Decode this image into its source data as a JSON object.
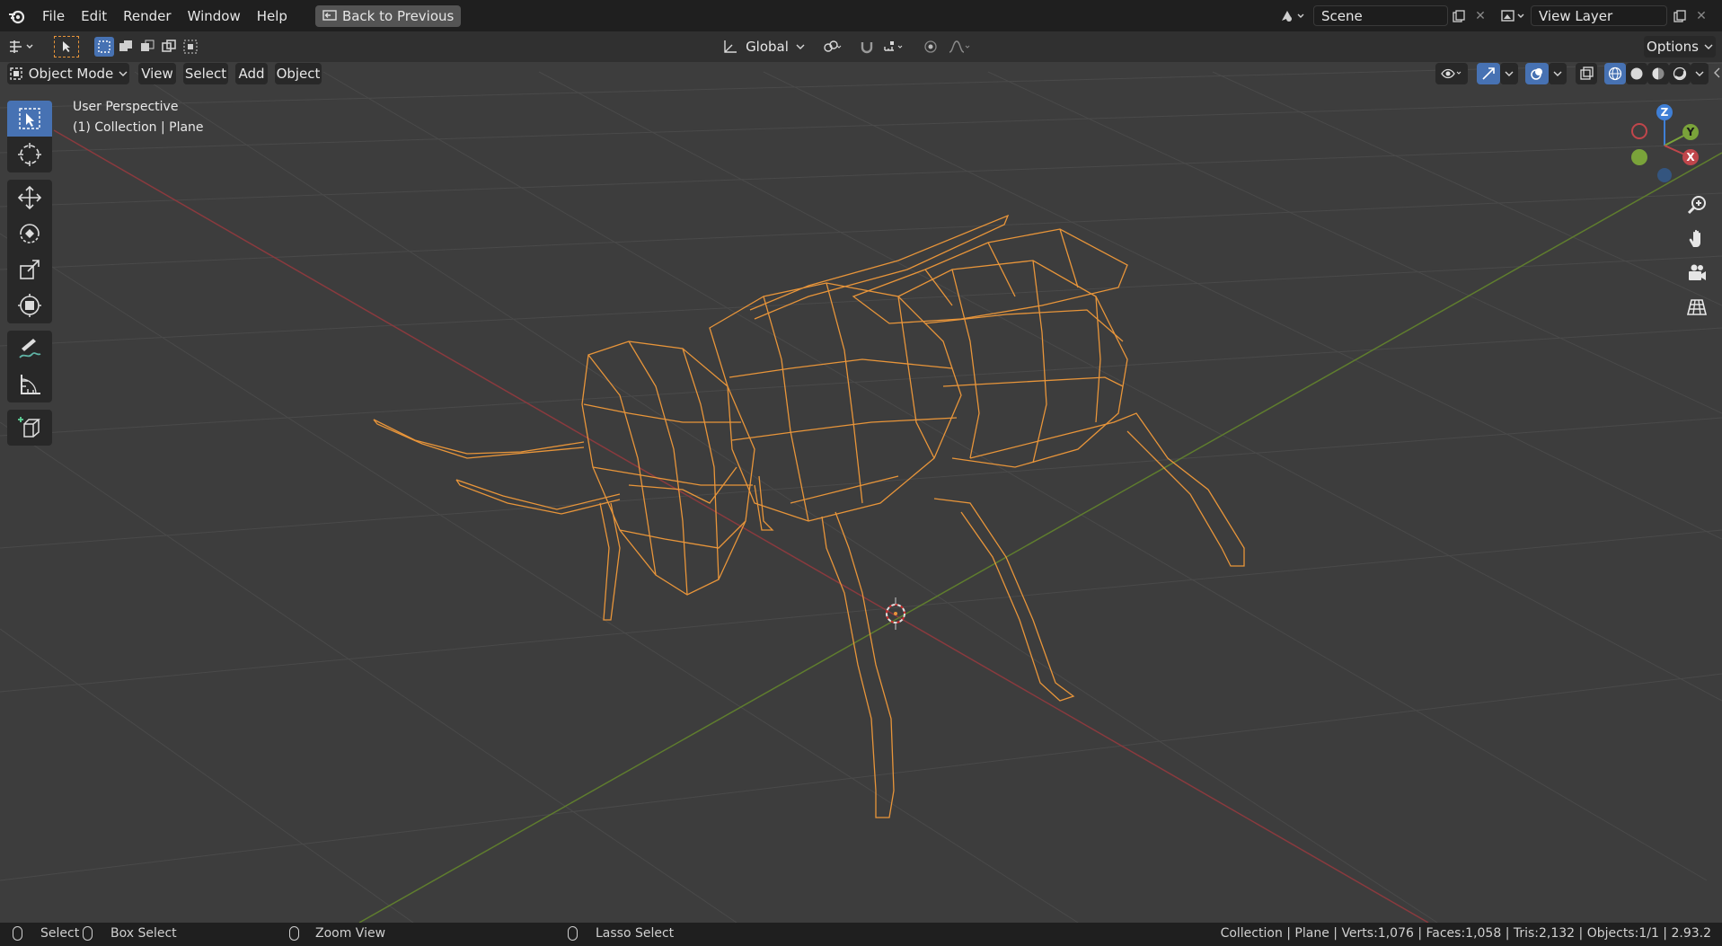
{
  "menu": {
    "items": [
      "File",
      "Edit",
      "Render",
      "Window",
      "Help"
    ],
    "back_button": "Back to Previous"
  },
  "scene": {
    "label": "Scene"
  },
  "view_layer": {
    "label": "View Layer"
  },
  "toolbar": {
    "orientation": "Global",
    "options_label": "Options"
  },
  "header": {
    "mode": "Object Mode",
    "menus": [
      "View",
      "Select",
      "Add",
      "Object"
    ]
  },
  "viewport": {
    "perspective": "User Perspective",
    "collection_info": "(1) Collection | Plane",
    "gizmo_axes": [
      "Z",
      "Y",
      "X"
    ]
  },
  "status": {
    "select": "Select",
    "box_select": "Box Select",
    "zoom_view": "Zoom View",
    "lasso_select": "Lasso Select",
    "stats": "Collection | Plane | Verts:1,076 | Faces:1,058 | Tris:2,132 | Objects:1/1 | 2.93.2"
  },
  "colors": {
    "accent": "#4772b3",
    "selection": "#e8953a",
    "x_axis": "#c0464b",
    "y_axis": "#7aa33a",
    "z_axis": "#3f7fd6"
  },
  "icons": [
    "blender-logo",
    "back-icon",
    "scene-icon",
    "view-layer-icon",
    "select-box-icon",
    "cursor-icon",
    "move-icon",
    "rotate-icon",
    "scale-icon",
    "transform-icon",
    "annotate-icon",
    "measure-icon",
    "add-cube-icon",
    "zoom-icon",
    "hand-icon",
    "camera-icon",
    "grid-icon"
  ]
}
